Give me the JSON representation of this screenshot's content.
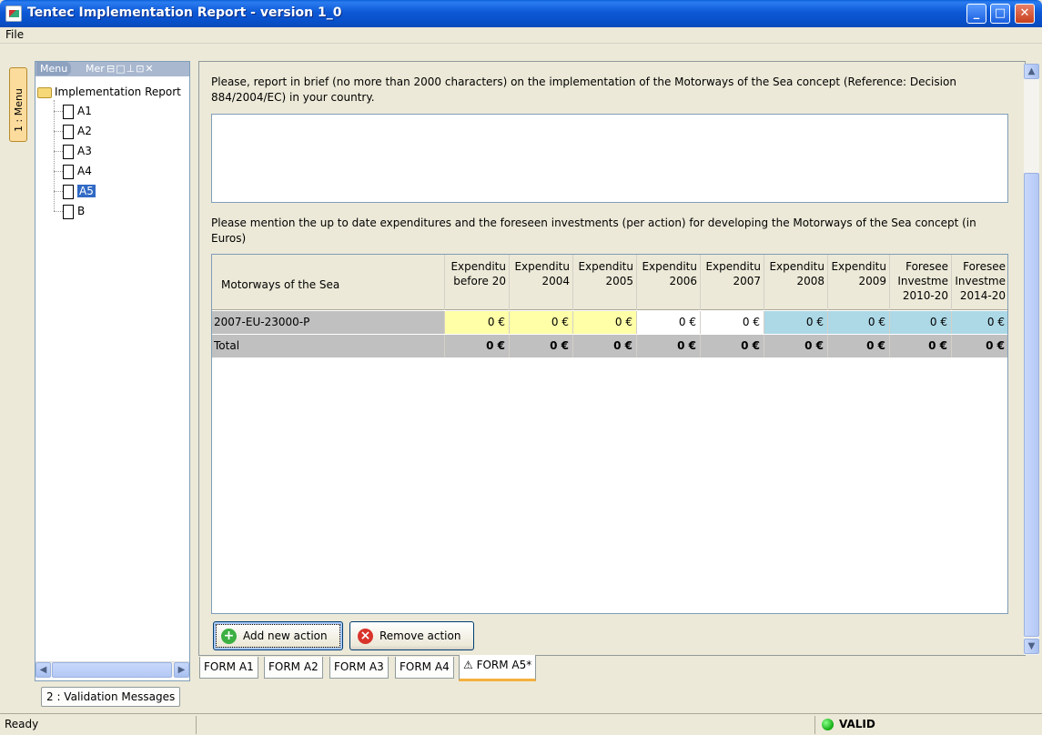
{
  "window": {
    "title": "Tentec Implementation Report - version 1_0",
    "min_glyph": "_",
    "max_glyph": "□",
    "close_glyph": "✕"
  },
  "menubar": {
    "file_label": "File"
  },
  "left_vtab": {
    "label": "1 : Menu"
  },
  "tree": {
    "header_menu": "Menu",
    "header_mer": "Mer",
    "header_controls": "⊟□⊥⊡✕",
    "root_label": "Implementation Report",
    "items": [
      "A1",
      "A2",
      "A3",
      "A4",
      "A5",
      "B"
    ],
    "selected": "A5"
  },
  "validation_tab": {
    "label": "2 : Validation Messages"
  },
  "main": {
    "question1": "Please, report in brief (no more than 2000 characters) on the implementation of the Motorways of the Sea concept (Reference: Decision 884/2004/EC) in your country.",
    "question1_value": "",
    "question2": "Please mention the up to date expenditures and the foreseen investments (per action) for developing the Motorways of the Sea concept (in Euros)",
    "grid": {
      "headers": [
        "Motorways of the Sea",
        "Expenditu before 20",
        "Expenditu 2004",
        "Expenditu 2005",
        "Expenditu 2006",
        "Expenditu 2007",
        "Expenditu 2008",
        "Expenditu 2009",
        "Foresee Investme 2010-20",
        "Foresee Investme 2014-20"
      ],
      "header_lines": [
        [
          "Motorways of the Sea"
        ],
        [
          "Expenditu",
          "before 20"
        ],
        [
          "Expenditu",
          "2004"
        ],
        [
          "Expenditu",
          "2005"
        ],
        [
          "Expenditu",
          "2006"
        ],
        [
          "Expenditu",
          "2007"
        ],
        [
          "Expenditu",
          "2008"
        ],
        [
          "Expenditu",
          "2009"
        ],
        [
          "Foresee",
          "Investme",
          "2010-20"
        ],
        [
          "Foresee",
          "Investme",
          "2014-20"
        ]
      ],
      "rows": [
        [
          "2007-EU-23000-P",
          "0 €",
          "0 €",
          "0 €",
          "0 €",
          "0 €",
          "0 €",
          "0 €",
          "0 €",
          "0 €"
        ]
      ],
      "total": [
        "Total",
        "0 €",
        "0 €",
        "0 €",
        "0 €",
        "0 €",
        "0 €",
        "0 €",
        "0 €",
        "0 €"
      ],
      "cell_colors": [
        "#c0c0c0",
        "#ffffa8",
        "#ffffa8",
        "#ffffa8",
        "#ffffff",
        "#ffffff",
        "#add8e6",
        "#add8e6",
        "#add8e6",
        "#add8e6"
      ]
    },
    "add_button": "Add new action",
    "remove_button": "Remove action"
  },
  "form_tabs": [
    "FORM A1",
    "FORM A2",
    "FORM A3",
    "FORM A4",
    "⚠ FORM A5*"
  ],
  "status": {
    "left": "Ready",
    "validity": "VALID",
    "valid_color": "#22bb22"
  }
}
